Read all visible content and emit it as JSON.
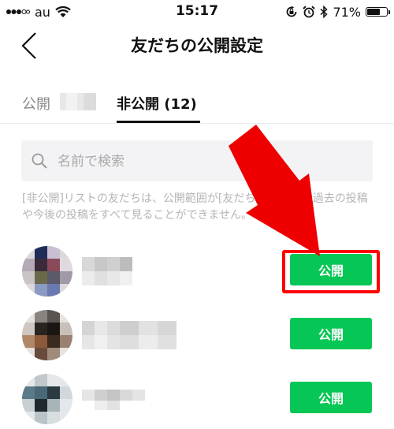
{
  "status_bar": {
    "carrier": "au",
    "time": "15:17",
    "battery_percent": "71%",
    "battery_level": 0.71,
    "icons": [
      "signal-icon",
      "wifi-icon",
      "rotation-lock-icon",
      "alarm-icon",
      "bluetooth-icon",
      "battery-icon"
    ]
  },
  "header": {
    "title": "友だちの公開設定",
    "back_icon": "chevron-left-icon"
  },
  "tabs": [
    {
      "label": "公開",
      "active": false
    },
    {
      "label": "非公開 (12)",
      "active": true
    }
  ],
  "search": {
    "placeholder": "名前で検索",
    "value": ""
  },
  "info_text": "[非公開]リストの友だちは、公開範囲が[友だち]や[公開]の過去の投稿や今後の投稿をすべて見ることができません。",
  "friends": [
    {
      "button_label": "公開",
      "highlighted": true
    },
    {
      "button_label": "公開",
      "highlighted": false
    },
    {
      "button_label": "公開",
      "highlighted": false
    }
  ],
  "colors": {
    "accent_green": "#06c755",
    "highlight_red": "#ff0000",
    "arrow_red": "#ee0000"
  }
}
